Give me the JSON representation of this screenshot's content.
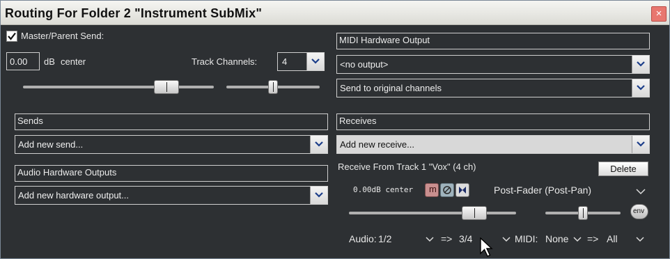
{
  "window": {
    "title": "Routing For Folder 2 \"Instrument SubMix\"",
    "close_glyph": "×"
  },
  "master": {
    "send_label": "Master/Parent Send:",
    "checked": true,
    "volume_value": "0.00",
    "db_label": "dB",
    "pan_label": "center",
    "track_channels_label": "Track Channels:",
    "track_channels_value": "4"
  },
  "midi_hw": {
    "header": "MIDI Hardware Output",
    "output_value": "<no output>",
    "channel_mode_value": "Send to original channels"
  },
  "sends": {
    "header": "Sends",
    "add_value": "Add new send..."
  },
  "receives": {
    "header": "Receives",
    "add_value": "Add new receive...",
    "item_title": "Receive From Track 1 \"Vox\" (4 ch)",
    "delete_label": "Delete",
    "vol_pan_readout": "0.00dB center",
    "mute_icon_text": "m",
    "mode_value": "Post-Fader (Post-Pan)",
    "env_label": "env",
    "audio_label": "Audio:",
    "audio_source": "1/2",
    "arrow1": "=>",
    "audio_dest": "3/4",
    "midi_label": "MIDI:",
    "midi_source": "None",
    "arrow2": "=>",
    "midi_dest": "All"
  },
  "audio_hw": {
    "header": "Audio Hardware Outputs",
    "add_value": "Add new hardware output..."
  },
  "sliders": {
    "master_volume_fraction": 0.75,
    "master_pan_fraction": 0.5,
    "receive_volume_fraction": 0.75,
    "receive_pan_fraction": 0.5
  }
}
